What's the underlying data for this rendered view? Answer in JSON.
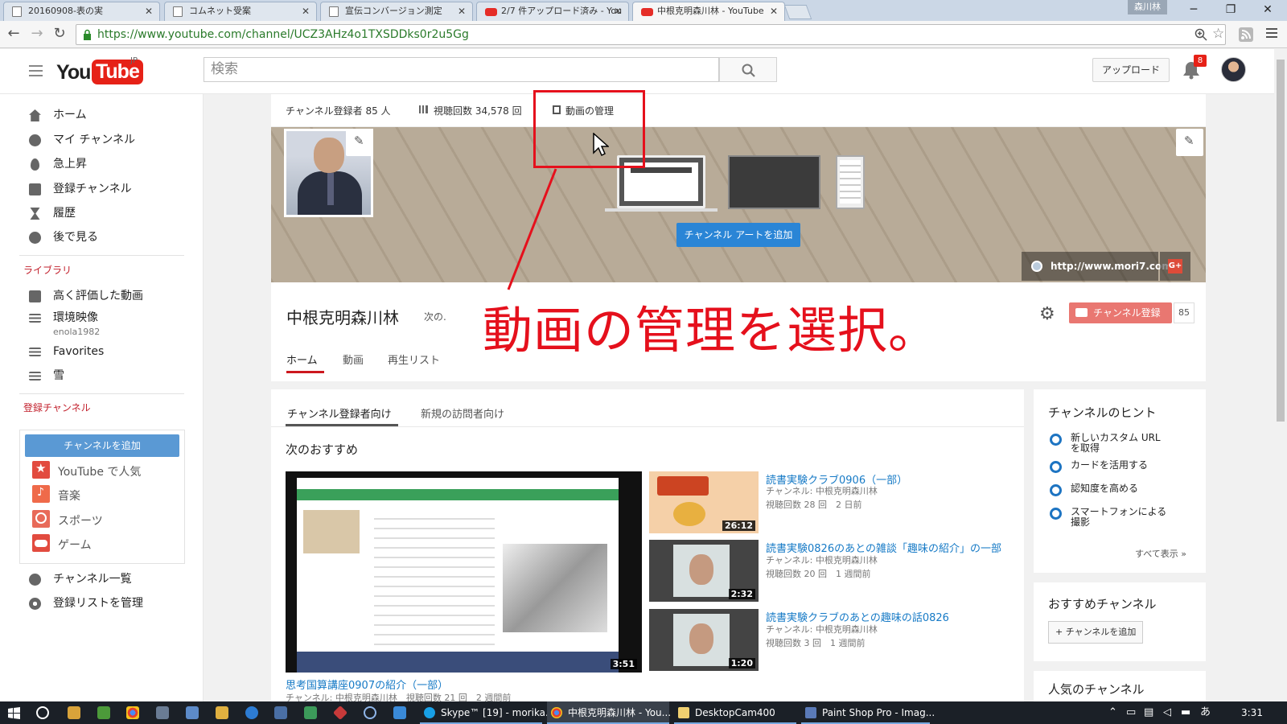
{
  "browser": {
    "tabs": [
      {
        "label": "20160908-表の実",
        "icon": "page-icon",
        "active": false
      },
      {
        "label": "コムネット受案",
        "icon": "page-icon",
        "active": false
      },
      {
        "label": "宣伝コンバージョン測定",
        "icon": "page-icon",
        "active": false
      },
      {
        "label": "2/7 件アップロード済み - You",
        "icon": "youtube-icon",
        "active": false
      },
      {
        "label": "中根克明森川林 - YouTube",
        "icon": "youtube-icon",
        "active": true
      }
    ],
    "window_user": "森川林",
    "url": "https://www.youtube.com/channel/UCZ3AHz4o1TXSDDks0r2u5Gg"
  },
  "youtube_header": {
    "logo_you": "You",
    "logo_tube": "Tube",
    "logo_region": "JP",
    "search_placeholder": "検索",
    "upload_label": "アップロード",
    "notification_count": "8"
  },
  "sidebar": {
    "main": [
      "ホーム",
      "マイ チャンネル",
      "急上昇",
      "登録チャンネル",
      "履歴",
      "後で見る"
    ],
    "library_header": "ライブラリ",
    "library": [
      "高く評価した動画",
      "環境映像",
      "Favorites",
      "雪"
    ],
    "library_sub": "enola1982",
    "subs_header": "登録チャンネル",
    "add_channel": "チャンネルを追加",
    "subs": [
      "YouTube で人気",
      "音楽",
      "スポーツ",
      "ゲーム"
    ],
    "bottom": [
      "チャンネル一覧",
      "登録リストを管理"
    ]
  },
  "channel": {
    "subscribers_stat": "チャンネル登録者 85 人",
    "views_stat": "視聴回数 34,578 回",
    "manage_videos": "動画の管理",
    "add_art": "チャンネル アートを追加",
    "website": "http://www.mori7.com/",
    "gplus": "G+",
    "name": "中根克明森川林",
    "next": "次の.",
    "subscribe_label": "チャンネル登録",
    "subscribe_count": "85",
    "tabs": [
      "ホーム",
      "動画",
      "再生リスト"
    ]
  },
  "content": {
    "tabs": [
      "チャンネル登録者向け",
      "新規の訪問者向け"
    ],
    "rec_header": "次のおすすめ",
    "featured": {
      "duration": "3:51",
      "title": "思考国算講座0907の紹介（一部）",
      "meta": "チャンネル: 中根克明森川林　視聴回数 21 回　2 週間前"
    },
    "videos": [
      {
        "title": "読書実験クラブ0906（一部）",
        "channel": "チャンネル: 中根克明森川林",
        "meta": "視聴回数 28 回　2 日前",
        "duration": "26:12"
      },
      {
        "title": "読書実験0826のあとの雑談「趣味の紹介」の一部",
        "channel": "チャンネル: 中根克明森川林",
        "meta": "視聴回数 20 回　1 週間前",
        "duration": "2:32"
      },
      {
        "title": "読書実験クラブのあとの趣味の話0826",
        "channel": "チャンネル: 中根克明森川林",
        "meta": "視聴回数 3 回　1 週間前",
        "duration": "1:20"
      }
    ]
  },
  "right": {
    "hints_header": "チャンネルのヒント",
    "hints": [
      "新しいカスタム URL を取得",
      "カードを活用する",
      "認知度を高める",
      "スマートフォンによる撮影"
    ],
    "show_all": "すべて表示 »",
    "rec_channels_header": "おすすめチャンネル",
    "add_rec_channel": "+ チャンネルを追加",
    "popular_header": "人気のチャンネル"
  },
  "annotation": {
    "text": "動画の管理を選択。",
    "color": "#e5101c"
  },
  "taskbar": {
    "apps": [
      "Skype™ [19] - morika...",
      "中根克明森川林 - You...",
      "DesktopCam400",
      "Paint Shop Pro - Imag..."
    ],
    "ime": "あ",
    "clock": "3:31"
  }
}
